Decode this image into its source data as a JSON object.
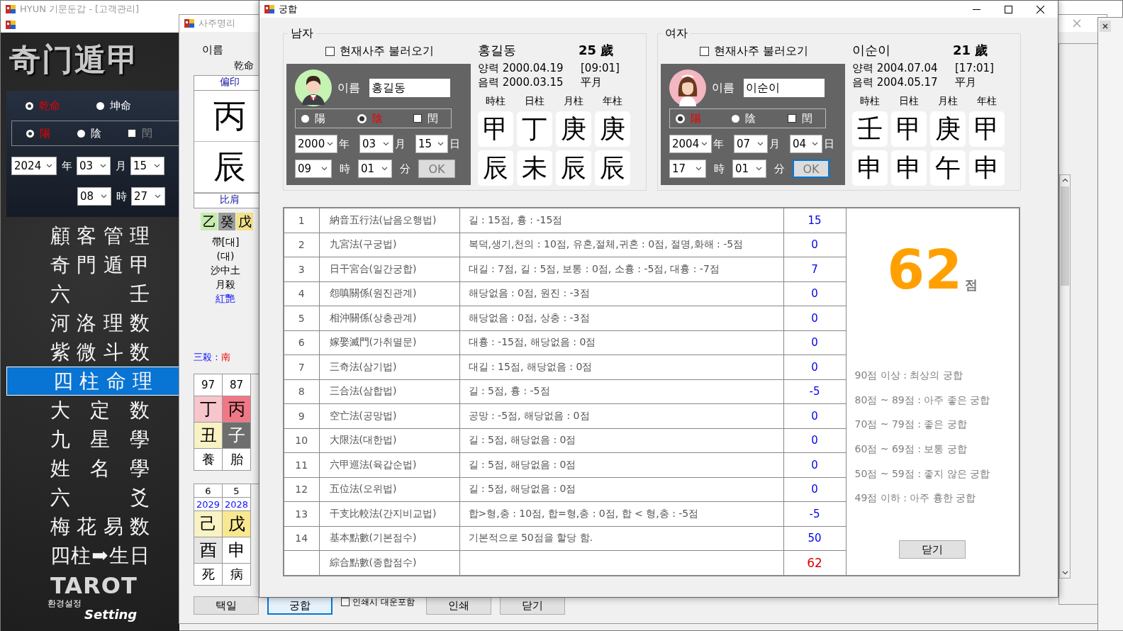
{
  "main_window": {
    "title": "HYUN 기문둔갑 - [고객관리]",
    "logo": "奇门遁甲",
    "gender_options": [
      {
        "label": "乾命",
        "selected": true
      },
      {
        "label": "坤命",
        "selected": false
      }
    ],
    "yinyang_options": [
      {
        "label": "陽",
        "selected": true
      },
      {
        "label": "陰",
        "selected": false
      }
    ],
    "leap": {
      "label": "閏",
      "checked": false,
      "disabled": true
    },
    "date_selects": [
      {
        "value": "2024",
        "unit": "年"
      },
      {
        "value": "03",
        "unit": "月"
      },
      {
        "value": "15"
      }
    ],
    "time_selects": [
      {
        "value": "08",
        "unit": "時"
      },
      {
        "value": "27"
      }
    ],
    "menu_items": [
      {
        "label": "顧客管理",
        "selected": false
      },
      {
        "label": "奇門遁甲",
        "selected": false
      },
      {
        "label": "六壬",
        "selected": false
      },
      {
        "label": "河洛理数",
        "selected": false
      },
      {
        "label": "紫微斗数",
        "selected": false
      },
      {
        "label": "四柱命理",
        "selected": true
      },
      {
        "label": "大定数",
        "selected": false
      },
      {
        "label": "九星學",
        "selected": false
      },
      {
        "label": "姓名學",
        "selected": false
      },
      {
        "label": "六爻",
        "selected": false
      },
      {
        "label": "梅花易数",
        "selected": false
      },
      {
        "label": "四柱➡生日",
        "selected": false
      }
    ],
    "tarot": "TAROT",
    "settings_label": "환경설정",
    "settings_logo": "Setting"
  },
  "saju_window": {
    "title": "사주명리",
    "name_label": "이름",
    "gender": "乾命",
    "pillar": {
      "top_label": "偏印",
      "stem": "丙",
      "branch": "辰",
      "bottom_label": "比肩"
    },
    "hidden_stems": [
      {
        "char": "乙",
        "color": "#c8ecb0"
      },
      {
        "char": "癸",
        "color": "#9a9a9a"
      },
      {
        "char": "戊",
        "color": "#f0e28c"
      }
    ],
    "notes": [
      {
        "text": "帶[대]",
        "kind": "plain"
      },
      {
        "text": "(대)",
        "kind": "plain"
      },
      {
        "text": "沙中土",
        "kind": "plain"
      },
      {
        "text": "月殺",
        "kind": "plain"
      },
      {
        "text": "紅艷",
        "kind": "highlight"
      }
    ],
    "samsal": {
      "label": "三殺 :",
      "value": "南"
    },
    "luck_table": {
      "ages": [
        "97",
        "87"
      ],
      "stems": [
        {
          "char": "丁",
          "color": "#f6c6cc"
        },
        {
          "char": "丙",
          "color": "#f07886"
        }
      ],
      "branches": [
        {
          "char": "丑",
          "color": "#f8f2c4"
        },
        {
          "char": "子",
          "color": "#6e6e6e"
        }
      ],
      "stages": [
        "養",
        "胎"
      ]
    },
    "year_table": {
      "ages": [
        "6",
        "5"
      ],
      "years": [
        "2029",
        "2028"
      ],
      "stems": [
        {
          "char": "己",
          "color": "#f8f2c4"
        },
        {
          "char": "戊",
          "color": "#f8e890"
        }
      ],
      "branches": [
        {
          "char": "酉",
          "color": "#e6e6e6"
        },
        {
          "char": "申",
          "color": "#ffffff"
        }
      ],
      "stages": [
        "死",
        "病"
      ]
    },
    "footer": [
      {
        "kind": "button",
        "label": "택일",
        "selected": false
      },
      {
        "kind": "button",
        "label": "궁합",
        "selected": true
      },
      {
        "kind": "checkbox",
        "label": "인쇄시 대운포함",
        "checked": false
      },
      {
        "kind": "button",
        "label": "인쇄",
        "selected": false
      },
      {
        "kind": "button",
        "label": "닫기",
        "selected": false
      }
    ]
  },
  "gunghap_dialog": {
    "title": "궁합",
    "persons": [
      {
        "group": "남자",
        "kind": "male",
        "load_current": {
          "label": "현재사주 불러오기",
          "checked": false
        },
        "name_label": "이름",
        "name": "홍길동",
        "yinyang": [
          {
            "label": "陽",
            "selected": false
          },
          {
            "label": "陰",
            "selected": true
          }
        ],
        "leap": {
          "label": "閏",
          "checked": false
        },
        "date": [
          {
            "value": "2000",
            "unit": "年"
          },
          {
            "value": "03",
            "unit": "月"
          },
          {
            "value": "15",
            "unit": "日"
          }
        ],
        "time": [
          {
            "value": "09",
            "unit": "時"
          },
          {
            "value": "01",
            "unit": "分"
          }
        ],
        "ok": {
          "label": "OK",
          "focused": false
        },
        "display_name": "홍길동",
        "age": "25 歲",
        "solar": "양력 2000.04.19",
        "time_text": "[09:01]",
        "lunar": "음력 2000.03.15",
        "month_type": "平月",
        "pillar_headers": [
          "時柱",
          "日柱",
          "月柱",
          "年柱"
        ],
        "stems": [
          "甲",
          "丁",
          "庚",
          "庚"
        ],
        "branches": [
          "辰",
          "未",
          "辰",
          "辰"
        ]
      },
      {
        "group": "여자",
        "kind": "female",
        "load_current": {
          "label": "현재사주 불러오기",
          "checked": false
        },
        "name_label": "이름",
        "name": "이순이",
        "yinyang": [
          {
            "label": "陽",
            "selected": true
          },
          {
            "label": "陰",
            "selected": false
          }
        ],
        "leap": {
          "label": "閏",
          "checked": false
        },
        "date": [
          {
            "value": "2004",
            "unit": "年"
          },
          {
            "value": "07",
            "unit": "月"
          },
          {
            "value": "04",
            "unit": "日"
          }
        ],
        "time": [
          {
            "value": "17",
            "unit": "時"
          },
          {
            "value": "01",
            "unit": "分"
          }
        ],
        "ok": {
          "label": "OK",
          "focused": true
        },
        "display_name": "이순이",
        "age": "21 歲",
        "solar": "양력 2004.07.04",
        "time_text": "[17:01]",
        "lunar": "음력 2004.05.17",
        "month_type": "平月",
        "pillar_headers": [
          "時柱",
          "日柱",
          "月柱",
          "年柱"
        ],
        "stems": [
          "壬",
          "甲",
          "庚",
          "甲"
        ],
        "branches": [
          "申",
          "申",
          "午",
          "申"
        ]
      }
    ],
    "results": [
      {
        "kind": "item",
        "no": "1",
        "method": "納音五行法(납음오행법)",
        "rule": "길 : 15점, 흉 : -15점",
        "score": "15"
      },
      {
        "kind": "item",
        "no": "2",
        "method": "九宮法(구궁법)",
        "rule": "복덕,생기,천의 : 10점, 유혼,절체,귀혼 : 0점, 절명,화해 : -5점",
        "score": "0"
      },
      {
        "kind": "item",
        "no": "3",
        "method": "日干宮合(일간궁합)",
        "rule": "대길 : 7점, 길 : 5점, 보통 : 0점, 소흉 : -5점, 대흉 : -7점",
        "score": "7"
      },
      {
        "kind": "item",
        "no": "4",
        "method": "怨嗔關係(원진관계)",
        "rule": "해당없음 : 0점, 원진 : -3점",
        "score": "0"
      },
      {
        "kind": "item",
        "no": "5",
        "method": "相沖關係(상충관계)",
        "rule": "해당없음 : 0점, 상충 : -3점",
        "score": "0"
      },
      {
        "kind": "item",
        "no": "6",
        "method": "嫁娶滅門(가취멸문)",
        "rule": "대흉 : -15점, 해당없음 : 0점",
        "score": "0"
      },
      {
        "kind": "item",
        "no": "7",
        "method": "三奇法(삼기법)",
        "rule": "대길 : 15점, 해당없음 : 0점",
        "score": "0"
      },
      {
        "kind": "item",
        "no": "8",
        "method": "三合法(삼합법)",
        "rule": "길 : 5점, 흉 : -5점",
        "score": "-5"
      },
      {
        "kind": "item",
        "no": "9",
        "method": "空亡法(공망법)",
        "rule": "공망 : -5점, 해당없음 : 0점",
        "score": "0"
      },
      {
        "kind": "item",
        "no": "10",
        "method": "大限法(대한법)",
        "rule": "길 : 5점, 해당없음 : 0점",
        "score": "0"
      },
      {
        "kind": "item",
        "no": "11",
        "method": "六甲巡法(육갑순법)",
        "rule": "길 : 5점, 해당없음 : 0점",
        "score": "0"
      },
      {
        "kind": "item",
        "no": "12",
        "method": "五位法(오위법)",
        "rule": "길 : 5점, 해당없음 : 0점",
        "score": "0"
      },
      {
        "kind": "item",
        "no": "13",
        "method": "干支比較法(간지비교법)",
        "rule": "합>형,충 : 10점, 합=형,충 : 0점, 합 < 형,충 : -5점",
        "score": "-5"
      },
      {
        "kind": "item",
        "no": "14",
        "method": "基本點數(기본점수)",
        "rule": "기본적으로 50점을 할당 함.",
        "score": "50"
      },
      {
        "kind": "total",
        "method": "綜合點數(종합점수)",
        "score": "62"
      }
    ],
    "total_score": "62",
    "score_unit": "점",
    "legend": [
      "90점 이상 : 최상의 궁합",
      "80점 ~ 89점 : 아주 좋은 궁합",
      "70점 ~ 79점 : 좋은 궁합",
      "60점 ~ 69점 : 보통 궁합",
      "50점 ~ 59점 : 좋지 않은 궁합",
      "49점 이하 :  아주 흉한 궁합"
    ],
    "close_button": "닫기"
  }
}
